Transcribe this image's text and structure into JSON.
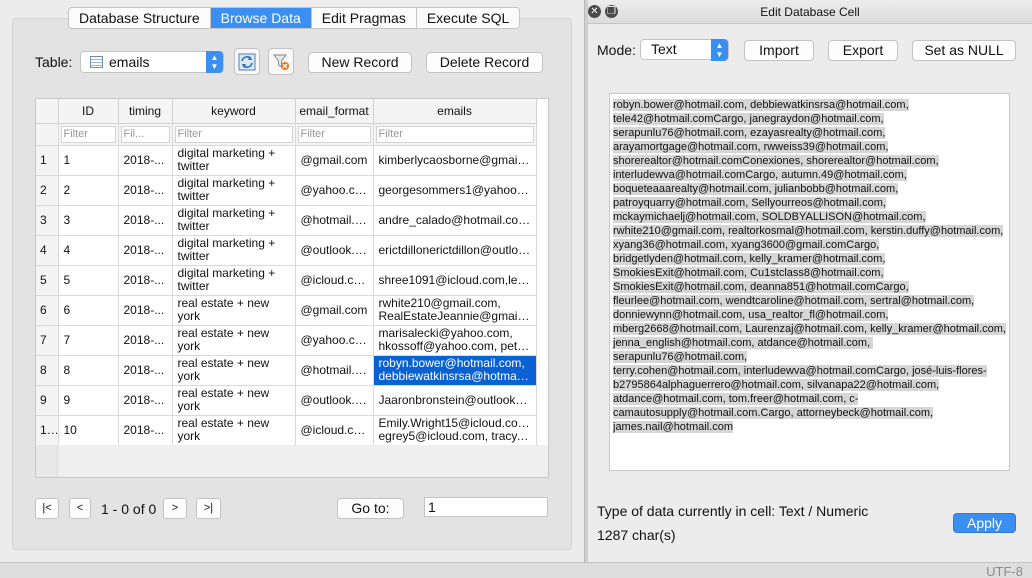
{
  "tabs": [
    "Database Structure",
    "Browse Data",
    "Edit Pragmas",
    "Execute SQL"
  ],
  "active_tab": 1,
  "browse": {
    "table_label": "Table:",
    "table_name": "emails",
    "new_record": "New Record",
    "delete_record": "Delete Record",
    "columns": [
      "ID",
      "timing",
      "keyword",
      "email_format",
      "emails"
    ],
    "filter_placeholders": [
      "Filter",
      "Fil...",
      "Filter",
      "Filter",
      "Filter"
    ],
    "rows": [
      {
        "rn": "1",
        "id": "1",
        "timing": "2018-...",
        "keyword": "digital marketing + twitter",
        "format": "@gmail.com",
        "emails": [
          "kimberlycaosborne@gmail.co..."
        ]
      },
      {
        "rn": "2",
        "id": "2",
        "timing": "2018-...",
        "keyword": "digital marketing + twitter",
        "format": "@yahoo.com",
        "emails": [
          "georgesommers1@yahoo.co..."
        ]
      },
      {
        "rn": "3",
        "id": "3",
        "timing": "2018-...",
        "keyword": "digital marketing + twitter",
        "format": "@hotmail.com",
        "emails": [
          "andre_calado@hotmail.com,s..."
        ]
      },
      {
        "rn": "4",
        "id": "4",
        "timing": "2018-...",
        "keyword": "digital marketing + twitter",
        "format": "@outlook.c...",
        "emails": [
          "erictdillonerictdillon@outlook...."
        ]
      },
      {
        "rn": "5",
        "id": "5",
        "timing": "2018-...",
        "keyword": "digital marketing + twitter",
        "format": "@icloud.com",
        "emails": [
          "shree1091@icloud.com,lenna..."
        ]
      },
      {
        "rn": "6",
        "id": "6",
        "timing": "2018-...",
        "keyword": "real estate + new york",
        "format": "@gmail.com",
        "emails": [
          "rwhite210@gmail.com,",
          "RealEstateJeannie@gmail.co..."
        ]
      },
      {
        "rn": "7",
        "id": "7",
        "timing": "2018-...",
        "keyword": "real estate + new york",
        "format": "@yahoo.com",
        "emails": [
          "marisalecki@yahoo.com,",
          "hkossoff@yahoo.com, petert..."
        ]
      },
      {
        "rn": "8",
        "id": "8",
        "timing": "2018-...",
        "keyword": "real estate + new york",
        "format": "@hotmail.com",
        "emails": [
          "robyn.bower@hotmail.com,",
          "debbiewatkinsrsa@hotmail.co..."
        ]
      },
      {
        "rn": "9",
        "id": "9",
        "timing": "2018-...",
        "keyword": "real estate + new york",
        "format": "@outlook.c...",
        "emails": [
          "Jaaronbronstein@outlook.com"
        ]
      },
      {
        "rn": "10",
        "id": "10",
        "timing": "2018-...",
        "keyword": "real estate + new york",
        "format": "@icloud.com",
        "emails": [
          "Emily.Wright15@icloud.com,",
          "egrey5@icloud.com, tracy.ho..."
        ]
      }
    ],
    "selected_row": 7,
    "nav": {
      "first": "|<",
      "prev": "<",
      "status": "1 - 0 of 0",
      "next": ">",
      "last": ">|",
      "goto_label": "Go to:",
      "goto_value": "1"
    }
  },
  "editor": {
    "title": "Edit Database Cell",
    "mode_label": "Mode:",
    "mode_value": "Text",
    "import": "Import",
    "export": "Export",
    "set_null": "Set as NULL",
    "content_lines": [
      "robyn.bower@hotmail.com, debbiewatkinsrsa@hotmail.com,",
      "tele42@hotmail.comCargo, janegraydon@hotmail.com,",
      "serapunlu76@hotmail.com, ezayasrealty@hotmail.com,",
      "arayamortgage@hotmail.com, rwweiss39@hotmail.com,",
      "shorerealtor@hotmail.comConexiones, shorerealtor@hotmail.com,",
      "interludewva@hotmail.comCargo, autumn.49@hotmail.com,",
      "boqueteaaarealty@hotmail.com, julianbobb@hotmail.com,",
      "patroyquarry@hotmail.com, Sellyourreos@hotmail.com,",
      "mckaymichaelj@hotmail.com, SOLDBYALLISON@hotmail.com,",
      "rwhite210@gmail.com, realtorkosmal@hotmail.com, kerstin.duffy@hotmail.com,",
      "xyang36@hotmail.com, xyang3600@gmail.comCargo,",
      "bridgetlyden@hotmail.com, kelly_kramer@hotmail.com,",
      "SmokiesExit@hotmail.com, Cu1stclass8@hotmail.com,",
      "SmokiesExit@hotmail.com, deanna851@hotmail.comCargo,",
      "fleurlee@hotmail.com, wendtcaroline@hotmail.com, sertral@hotmail.com,",
      "donniewynn@hotmail.com, usa_realtor_fl@hotmail.com,",
      "mberg2668@hotmail.com, Laurenzaj@hotmail.com, kelly_kramer@hotmail.com,",
      "jenna_english@hotmail.com, atdance@hotmail.com, serapunlu76@hotmail.com,",
      "terry.cohen@hotmail.com, interludewva@hotmail.comCargo, josé-luis-flores-",
      "b2795864alphaguerrero@hotmail.com, silvanapa22@hotmail.com,",
      "atdance@hotmail.com, tom.freer@hotmail.com, c-",
      "camautosupply@hotmail.com.Cargo, attorneybeck@hotmail.com,",
      "james.nail@hotmail.com"
    ],
    "type_info": "Type of data currently in cell: Text / Numeric",
    "char_count": "1287 char(s)",
    "apply": "Apply"
  },
  "status": {
    "encoding": "UTF-8"
  }
}
